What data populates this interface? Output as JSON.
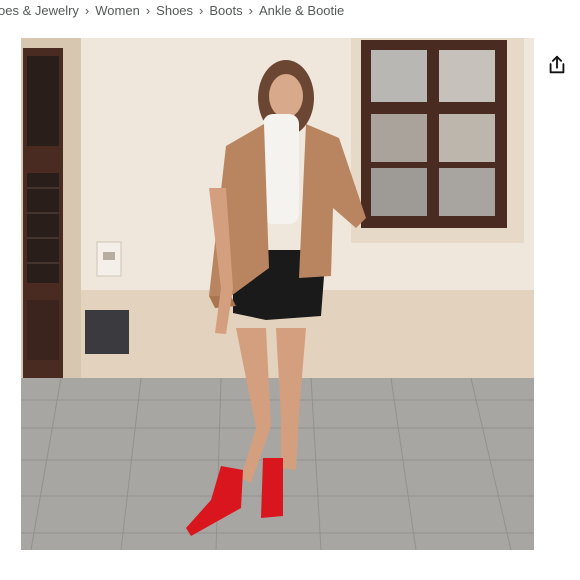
{
  "breadcrumb": {
    "items": [
      {
        "label": "oes & Jewelry"
      },
      {
        "label": "Women"
      },
      {
        "label": "Shoes"
      },
      {
        "label": "Boots"
      },
      {
        "label": "Ankle & Bootie"
      }
    ],
    "separator": "›"
  },
  "product_image": {
    "alt": "",
    "colors": {
      "wall": "#efe6dc",
      "pavement": "#a8a6a3",
      "jacket": "#b98560",
      "skirt": "#1b1a1a",
      "boots": "#d9161d",
      "window_frame": "#4a2b22"
    }
  },
  "share_button": {
    "icon": "share-icon"
  }
}
